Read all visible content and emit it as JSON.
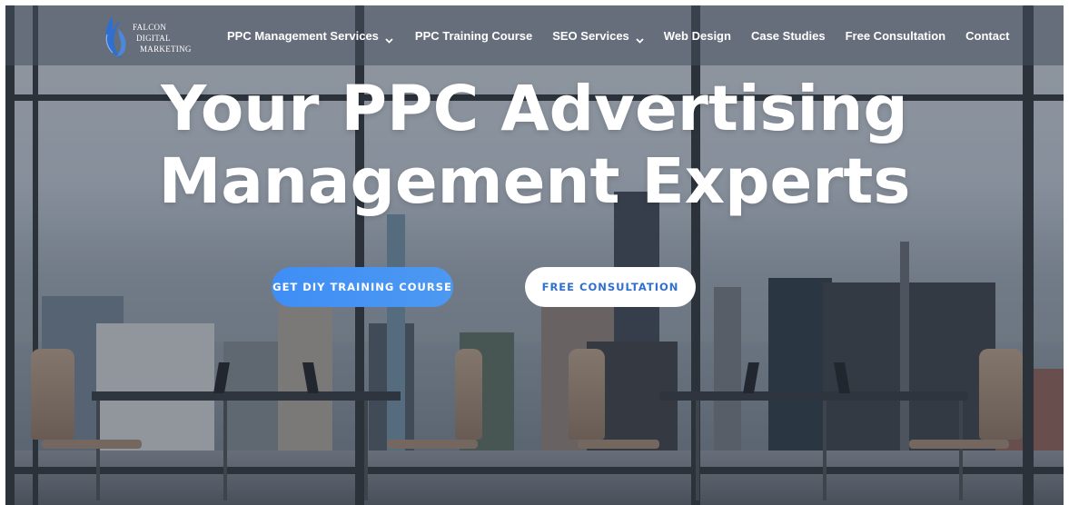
{
  "logo": {
    "line1": "FALCON",
    "line2": "DIGITAL",
    "line3": "MARKETING",
    "icon": "falcon-wing-icon",
    "color": "#2f6fd0"
  },
  "nav": {
    "items": [
      {
        "label": "PPC Management Services",
        "has_dropdown": true
      },
      {
        "label": "PPC Training Course",
        "has_dropdown": false
      },
      {
        "label": "SEO Services",
        "has_dropdown": true
      },
      {
        "label": "Web Design",
        "has_dropdown": false
      },
      {
        "label": "Case Studies",
        "has_dropdown": false
      },
      {
        "label": "Free Consultation",
        "has_dropdown": false
      },
      {
        "label": "Contact",
        "has_dropdown": false
      }
    ],
    "dropdown_icon": "chevron-down-icon"
  },
  "hero": {
    "title_line1": "Your PPC Advertising",
    "title_line2": "Management Experts",
    "primary_button": "GET DIY TRAINING COURSE",
    "secondary_button": "FREE CONSULTATION"
  },
  "colors": {
    "primary_button_bg": "#4592f4",
    "secondary_button_text": "#2f6fd0",
    "text": "#ffffff"
  }
}
